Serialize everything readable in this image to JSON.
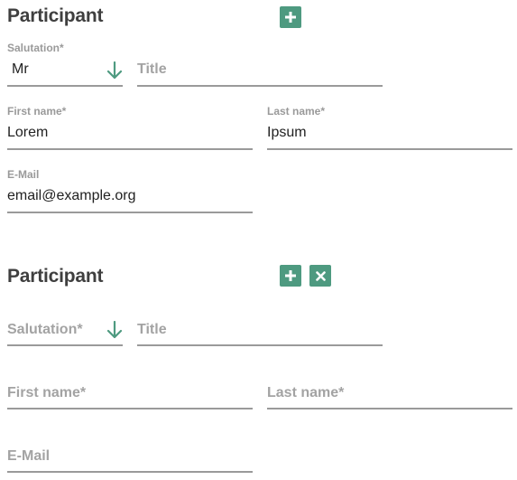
{
  "accent_color": "#4e9a80",
  "participants": [
    {
      "heading": "Participant",
      "add_icon": "plus-icon",
      "salutation": {
        "label": "Salutation*",
        "value": "Mr",
        "icon": "arrow-down-icon"
      },
      "title": {
        "placeholder": "Title"
      },
      "first_name": {
        "label": "First name*",
        "value": "Lorem"
      },
      "last_name": {
        "label": "Last name*",
        "value": "Ipsum"
      },
      "email": {
        "label": "E-Mail",
        "value": "email@example.org"
      }
    },
    {
      "heading": "Participant",
      "add_icon": "plus-icon",
      "remove_icon": "close-icon",
      "salutation": {
        "placeholder": "Salutation*",
        "icon": "arrow-down-icon"
      },
      "title": {
        "placeholder": "Title"
      },
      "first_name": {
        "placeholder": "First name*"
      },
      "last_name": {
        "placeholder": "Last name*"
      },
      "email": {
        "placeholder": "E-Mail"
      }
    }
  ]
}
